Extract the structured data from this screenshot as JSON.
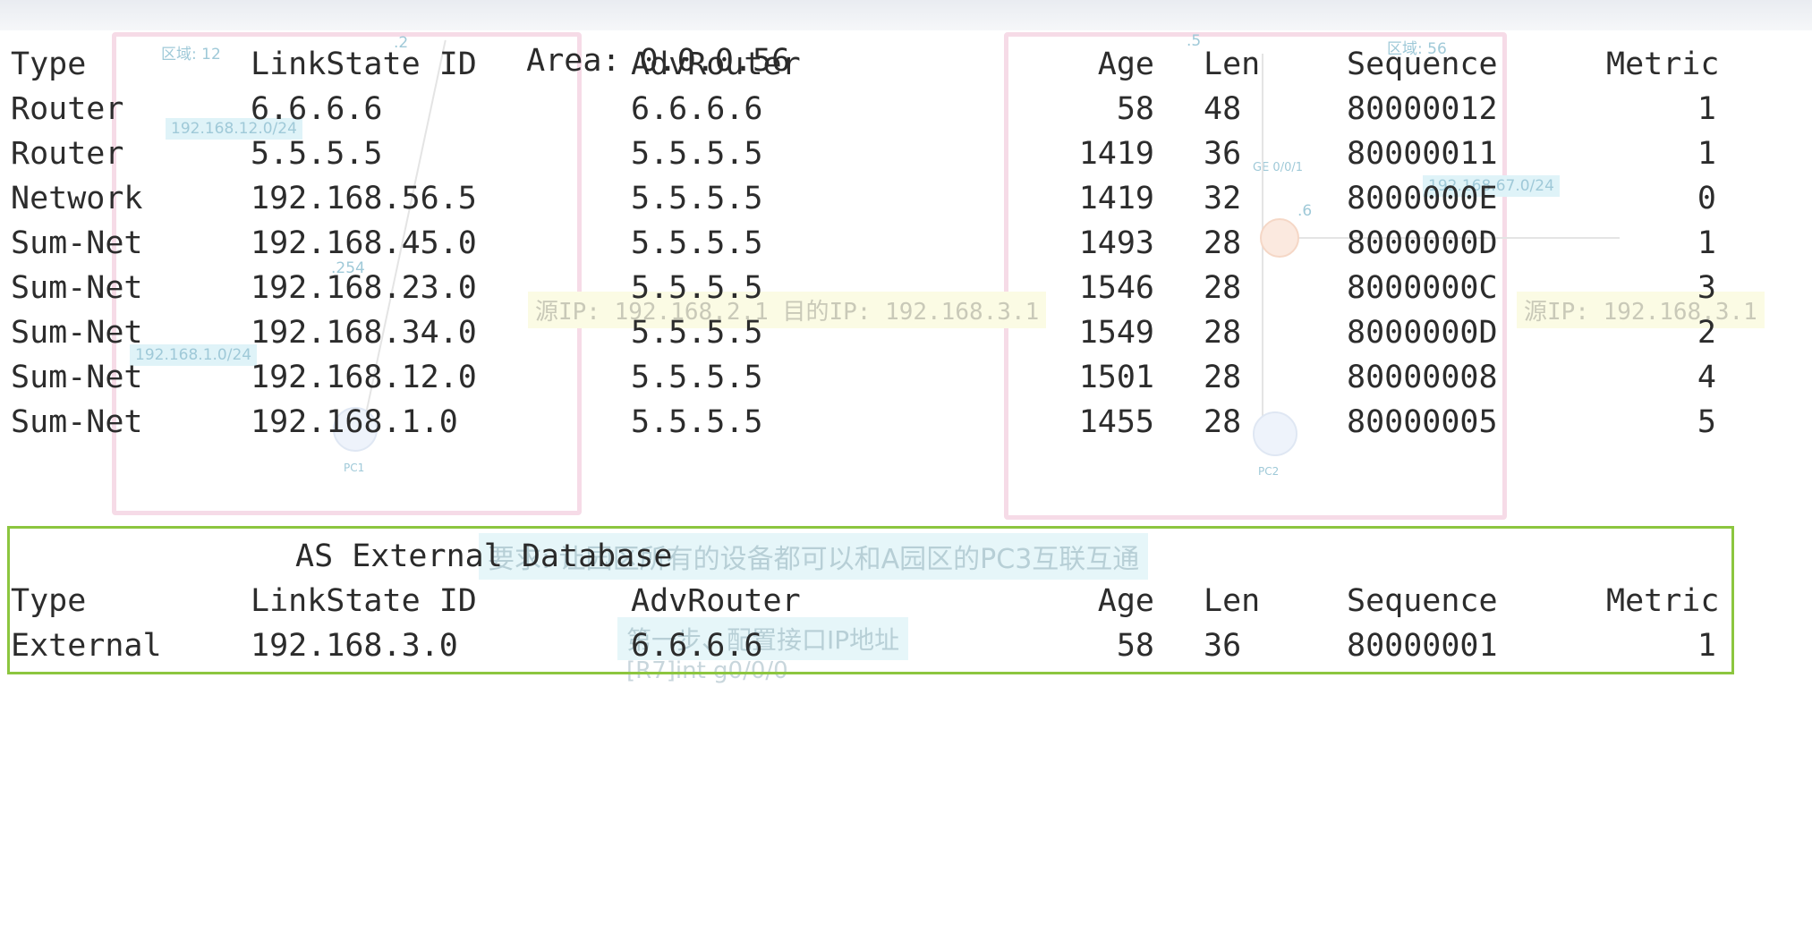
{
  "area_header": {
    "label": "Area:",
    "value": "0.0.0.56"
  },
  "columns": {
    "type": "Type",
    "linkstate_id": "LinkState ID",
    "adv_router": "AdvRouter",
    "age": "Age",
    "len": "Len",
    "sequence": "Sequence",
    "metric": "Metric"
  },
  "area_rows": [
    {
      "type": "Router",
      "id": "6.6.6.6",
      "adv": "6.6.6.6",
      "age": "58",
      "len": "48",
      "seq": "80000012",
      "metric": "1"
    },
    {
      "type": "Router",
      "id": "5.5.5.5",
      "adv": "5.5.5.5",
      "age": "1419",
      "len": "36",
      "seq": "80000011",
      "metric": "1"
    },
    {
      "type": "Network",
      "id": "192.168.56.5",
      "adv": "5.5.5.5",
      "age": "1419",
      "len": "32",
      "seq": "8000000E",
      "metric": "0"
    },
    {
      "type": "Sum-Net",
      "id": "192.168.45.0",
      "adv": "5.5.5.5",
      "age": "1493",
      "len": "28",
      "seq": "8000000D",
      "metric": "1"
    },
    {
      "type": "Sum-Net",
      "id": "192.168.23.0",
      "adv": "5.5.5.5",
      "age": "1546",
      "len": "28",
      "seq": "8000000C",
      "metric": "3"
    },
    {
      "type": "Sum-Net",
      "id": "192.168.34.0",
      "adv": "5.5.5.5",
      "age": "1549",
      "len": "28",
      "seq": "8000000D",
      "metric": "2"
    },
    {
      "type": "Sum-Net",
      "id": "192.168.12.0",
      "adv": "5.5.5.5",
      "age": "1501",
      "len": "28",
      "seq": "80000008",
      "metric": "4"
    },
    {
      "type": "Sum-Net",
      "id": "192.168.1.0",
      "adv": "5.5.5.5",
      "age": "1455",
      "len": "28",
      "seq": "80000005",
      "metric": "5"
    }
  ],
  "external_header": "AS External Database",
  "external_rows": [
    {
      "type": "External",
      "id": "192.168.3.0",
      "adv": "6.6.6.6",
      "age": "58",
      "len": "36",
      "seq": "80000001",
      "metric": "1"
    }
  ],
  "background": {
    "zone_left": "区域: 12",
    "zone_right": "区域: 56",
    "subnet_left": "192.168.12.0/24",
    "subnet_right": "192.168.67.0/24",
    "subnet_left2": "192.168.1.0/24",
    "src_dst": "源IP: 192.168.2.1   目的IP: 192.168.3.1",
    "src_right": "源IP: 192.168.3.1",
    "pc_left": "PC1",
    "pc_right": "PC2",
    "req_text": "要求: 让园区所有的设备都可以和A园区的PC3互联互通",
    "step_text": "第一步、配置接口IP地址",
    "cmd_text": "[R7]int g0/0/0",
    "ge_label": "GE 0/0/1",
    "if_dot2": ".2",
    "if_dot5": ".5",
    "if_dot6": ".6",
    "if_dot254": ".254"
  },
  "colors": {
    "highlight_border": "#8cc63f",
    "terminal_text": "#2c2c2c",
    "area_box": "#f6dbe7"
  }
}
